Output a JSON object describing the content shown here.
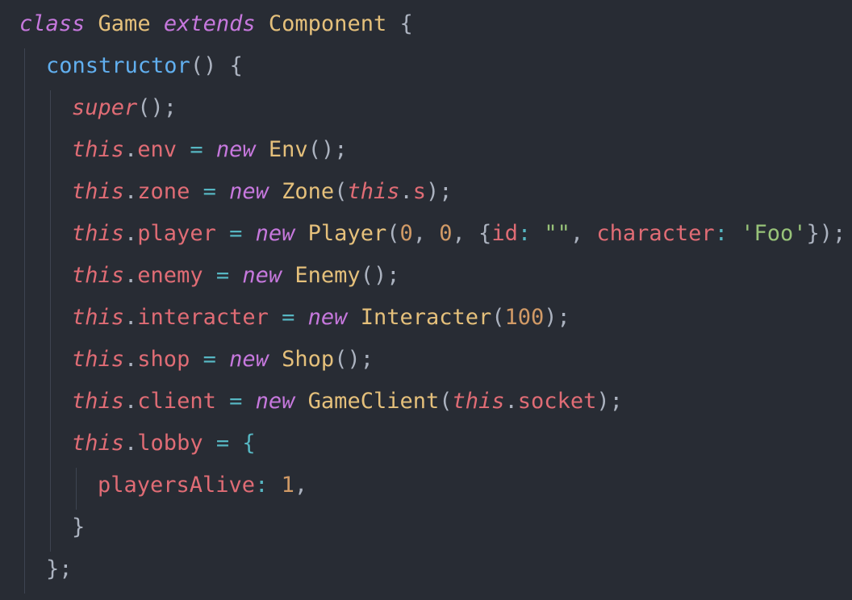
{
  "lines": [
    [
      {
        "t": "class",
        "c": "kw"
      },
      {
        "t": " ",
        "c": "pun"
      },
      {
        "t": "Game",
        "c": "cls"
      },
      {
        "t": " ",
        "c": "pun"
      },
      {
        "t": "extends",
        "c": "kw"
      },
      {
        "t": " ",
        "c": "pun"
      },
      {
        "t": "Component",
        "c": "cls"
      },
      {
        "t": " {",
        "c": "pun"
      }
    ],
    [
      {
        "t": "constructor",
        "c": "fn"
      },
      {
        "t": "() {",
        "c": "pun"
      }
    ],
    [
      {
        "t": "super",
        "c": "sup"
      },
      {
        "t": "();",
        "c": "pun"
      }
    ],
    [
      {
        "t": "this",
        "c": "this"
      },
      {
        "t": ".",
        "c": "pun"
      },
      {
        "t": "env",
        "c": "prop"
      },
      {
        "t": " = ",
        "c": "op"
      },
      {
        "t": "new",
        "c": "kw"
      },
      {
        "t": " ",
        "c": "pun"
      },
      {
        "t": "Env",
        "c": "cls"
      },
      {
        "t": "();",
        "c": "pun"
      }
    ],
    [
      {
        "t": "this",
        "c": "this"
      },
      {
        "t": ".",
        "c": "pun"
      },
      {
        "t": "zone",
        "c": "prop"
      },
      {
        "t": " = ",
        "c": "op"
      },
      {
        "t": "new",
        "c": "kw"
      },
      {
        "t": " ",
        "c": "pun"
      },
      {
        "t": "Zone",
        "c": "cls"
      },
      {
        "t": "(",
        "c": "pun"
      },
      {
        "t": "this",
        "c": "this"
      },
      {
        "t": ".",
        "c": "pun"
      },
      {
        "t": "s",
        "c": "prop"
      },
      {
        "t": ");",
        "c": "pun"
      }
    ],
    [
      {
        "t": "this",
        "c": "this"
      },
      {
        "t": ".",
        "c": "pun"
      },
      {
        "t": "player",
        "c": "prop"
      },
      {
        "t": " = ",
        "c": "op"
      },
      {
        "t": "new",
        "c": "kw"
      },
      {
        "t": " ",
        "c": "pun"
      },
      {
        "t": "Player",
        "c": "cls"
      },
      {
        "t": "(",
        "c": "pun"
      },
      {
        "t": "0",
        "c": "num"
      },
      {
        "t": ", ",
        "c": "pun"
      },
      {
        "t": "0",
        "c": "num"
      },
      {
        "t": ", {",
        "c": "pun"
      },
      {
        "t": "id",
        "c": "prop"
      },
      {
        "t": ": ",
        "c": "op"
      },
      {
        "t": "\"\"",
        "c": "str"
      },
      {
        "t": ", ",
        "c": "pun"
      },
      {
        "t": "character",
        "c": "prop"
      },
      {
        "t": ": ",
        "c": "op"
      },
      {
        "t": "'Foo'",
        "c": "str"
      },
      {
        "t": "});",
        "c": "pun"
      }
    ],
    [
      {
        "t": "this",
        "c": "this"
      },
      {
        "t": ".",
        "c": "pun"
      },
      {
        "t": "enemy",
        "c": "prop"
      },
      {
        "t": " = ",
        "c": "op"
      },
      {
        "t": "new",
        "c": "kw"
      },
      {
        "t": " ",
        "c": "pun"
      },
      {
        "t": "Enemy",
        "c": "cls"
      },
      {
        "t": "();",
        "c": "pun"
      }
    ],
    [
      {
        "t": "this",
        "c": "this"
      },
      {
        "t": ".",
        "c": "pun"
      },
      {
        "t": "interacter",
        "c": "prop"
      },
      {
        "t": " = ",
        "c": "op"
      },
      {
        "t": "new",
        "c": "kw"
      },
      {
        "t": " ",
        "c": "pun"
      },
      {
        "t": "Interacter",
        "c": "cls"
      },
      {
        "t": "(",
        "c": "pun"
      },
      {
        "t": "100",
        "c": "num"
      },
      {
        "t": ");",
        "c": "pun"
      }
    ],
    [
      {
        "t": "this",
        "c": "this"
      },
      {
        "t": ".",
        "c": "pun"
      },
      {
        "t": "shop",
        "c": "prop"
      },
      {
        "t": " = ",
        "c": "op"
      },
      {
        "t": "new",
        "c": "kw"
      },
      {
        "t": " ",
        "c": "pun"
      },
      {
        "t": "Shop",
        "c": "cls"
      },
      {
        "t": "();",
        "c": "pun"
      }
    ],
    [
      {
        "t": "this",
        "c": "this"
      },
      {
        "t": ".",
        "c": "pun"
      },
      {
        "t": "client",
        "c": "prop"
      },
      {
        "t": " = ",
        "c": "op"
      },
      {
        "t": "new",
        "c": "kw"
      },
      {
        "t": " ",
        "c": "pun"
      },
      {
        "t": "GameClient",
        "c": "cls"
      },
      {
        "t": "(",
        "c": "pun"
      },
      {
        "t": "this",
        "c": "this"
      },
      {
        "t": ".",
        "c": "pun"
      },
      {
        "t": "socket",
        "c": "prop"
      },
      {
        "t": ");",
        "c": "pun"
      }
    ],
    [
      {
        "t": "this",
        "c": "this"
      },
      {
        "t": ".",
        "c": "pun"
      },
      {
        "t": "lobby",
        "c": "prop"
      },
      {
        "t": " = {",
        "c": "op"
      }
    ],
    [
      {
        "t": "playersAlive",
        "c": "prop"
      },
      {
        "t": ": ",
        "c": "op"
      },
      {
        "t": "1",
        "c": "num"
      },
      {
        "t": ",",
        "c": "pun"
      }
    ],
    [
      {
        "t": "}",
        "c": "pun"
      }
    ],
    [
      {
        "t": "};",
        "c": "pun"
      }
    ]
  ],
  "colors": {
    "background": "#282c34",
    "keyword": "#c678dd",
    "class_name": "#e5c07b",
    "function": "#61afef",
    "property": "#e06c75",
    "number": "#d19a66",
    "string": "#98c379",
    "punctuation": "#abb2bf",
    "operator": "#56b6c2"
  }
}
